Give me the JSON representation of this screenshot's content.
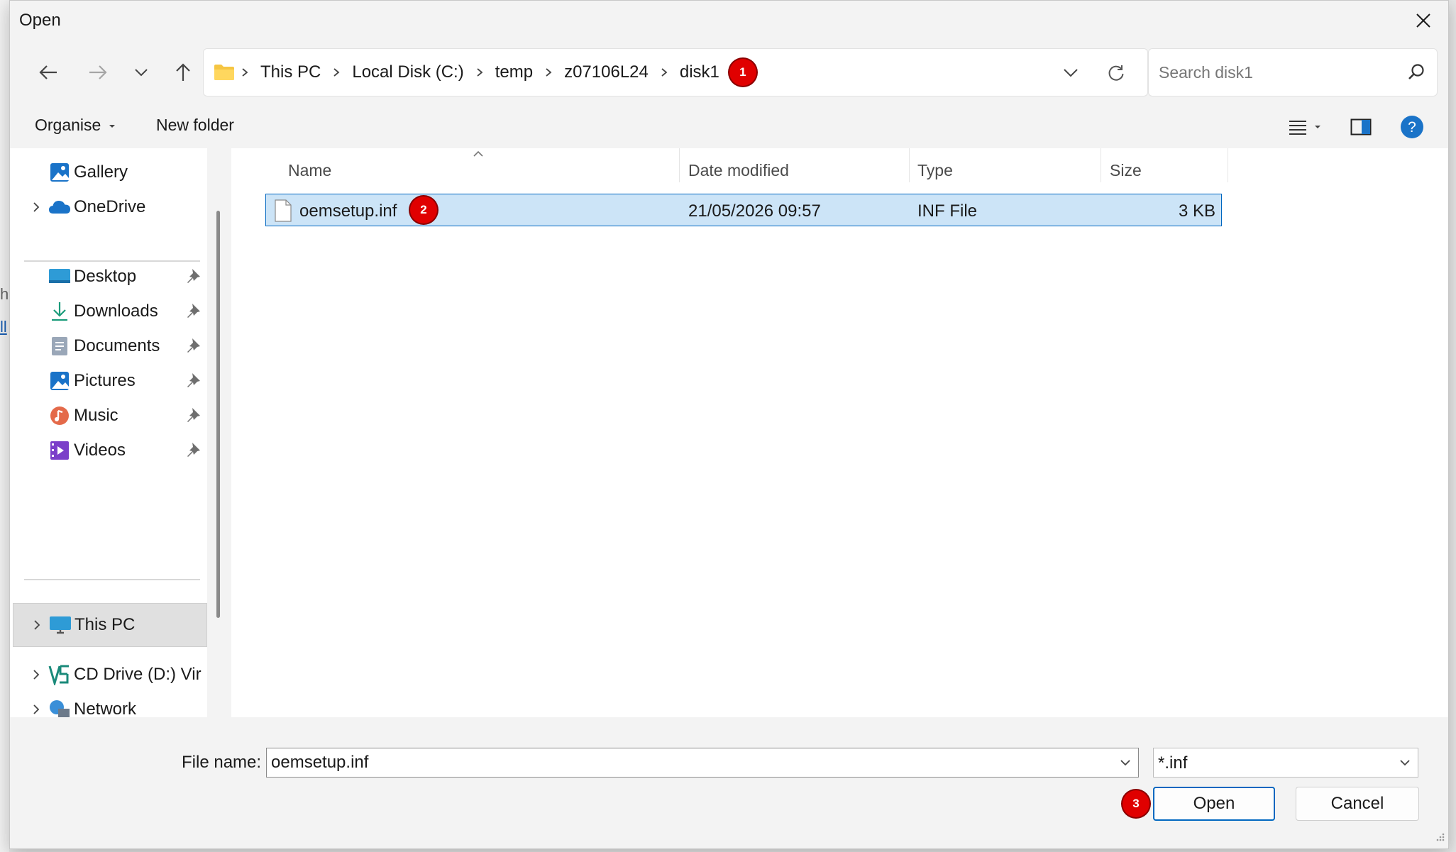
{
  "window": {
    "title": "Open"
  },
  "background": {
    "fragment1": "hi",
    "fragment2": "ll"
  },
  "navigation": {
    "breadcrumbs": [
      "This PC",
      "Local Disk (C:)",
      "temp",
      "z07106L24",
      "disk1"
    ],
    "search_placeholder": "Search disk1"
  },
  "commandbar": {
    "organise": "Organise",
    "new_folder": "New folder"
  },
  "navpane": {
    "items": [
      {
        "label": "Gallery",
        "icon": "gallery-icon",
        "expandable": false,
        "pinned": false
      },
      {
        "label": "OneDrive",
        "icon": "onedrive-icon",
        "expandable": true,
        "pinned": false
      },
      {
        "label": "Desktop",
        "icon": "desktop-icon",
        "expandable": false,
        "pinned": true
      },
      {
        "label": "Downloads",
        "icon": "downloads-icon",
        "expandable": false,
        "pinned": true
      },
      {
        "label": "Documents",
        "icon": "documents-icon",
        "expandable": false,
        "pinned": true
      },
      {
        "label": "Pictures",
        "icon": "pictures-icon",
        "expandable": false,
        "pinned": true
      },
      {
        "label": "Music",
        "icon": "music-icon",
        "expandable": false,
        "pinned": true
      },
      {
        "label": "Videos",
        "icon": "videos-icon",
        "expandable": false,
        "pinned": true
      },
      {
        "label": "This PC",
        "icon": "this-pc-icon",
        "expandable": true,
        "pinned": false,
        "selected": true
      },
      {
        "label": "CD Drive (D:) Vir",
        "icon": "cd-drive-icon",
        "expandable": true,
        "pinned": false
      },
      {
        "label": "Network",
        "icon": "network-icon",
        "expandable": true,
        "pinned": false
      }
    ]
  },
  "filelist": {
    "columns": [
      "Name",
      "Date modified",
      "Type",
      "Size"
    ],
    "rows": [
      {
        "name": "oemsetup.inf",
        "date": "21/05/2026 09:57",
        "type": "INF File",
        "size": "3 KB",
        "selected": true
      }
    ]
  },
  "footer": {
    "filename_label": "File name:",
    "filename_value": "oemsetup.inf",
    "filetype_value": "*.inf",
    "open_label": "Open",
    "cancel_label": "Cancel"
  },
  "badges": {
    "badge1": "1",
    "badge2": "2",
    "badge3": "3"
  },
  "colors": {
    "accent": "#0067c0",
    "selection": "#cce4f7",
    "badge": "#e00000"
  }
}
